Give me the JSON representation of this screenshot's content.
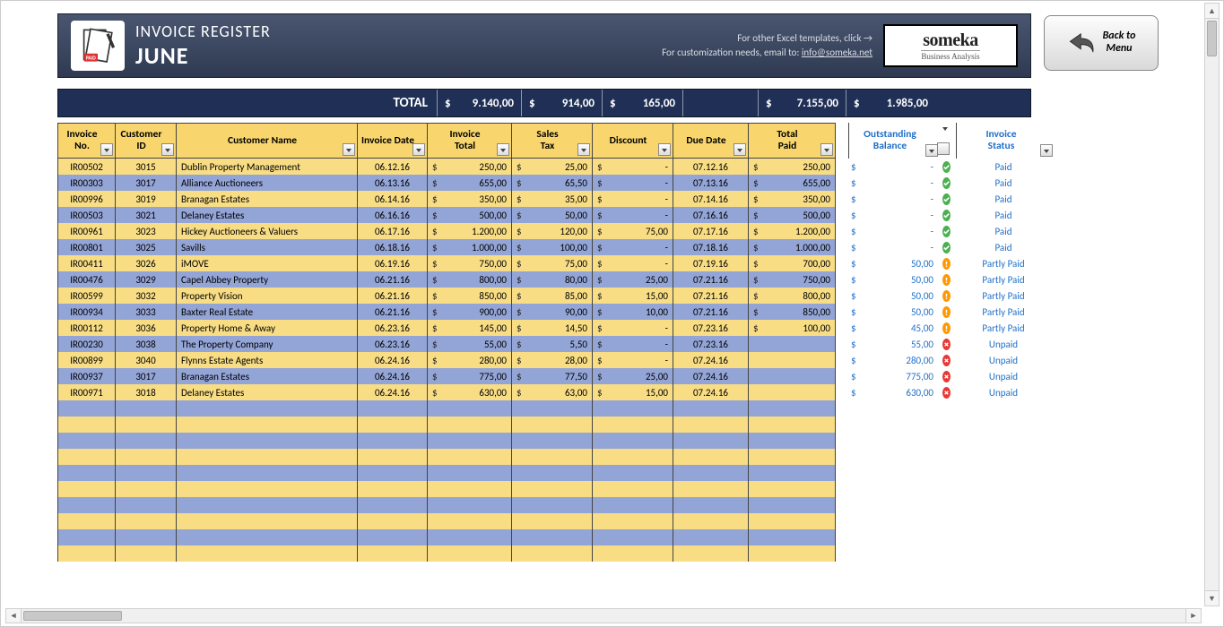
{
  "header": {
    "title": "INVOICE REGISTER",
    "month": "JUNE",
    "tip1": "For other Excel templates, click →",
    "tip2_pre": "For customization needs, email to: ",
    "tip2_link": "info@someka.net",
    "logo_name": "someka",
    "logo_sub": "Business Analysis",
    "back_label": "Back to\nMenu"
  },
  "totals": {
    "label": "TOTAL",
    "invoice_total": "9.140,00",
    "sales_tax": "914,00",
    "discount": "165,00",
    "total_paid": "7.155,00",
    "outstanding": "1.985,00"
  },
  "columns": [
    "Invoice\nNo.",
    "Customer\nID",
    "Customer Name",
    "Invoice Date",
    "Invoice\nTotal",
    "Sales\nTax",
    "Discount",
    "Due Date",
    "Total\nPaid",
    "Outstanding\nBalance",
    "Invoice\nStatus"
  ],
  "rows": [
    {
      "inv": "IR00502",
      "cust": "3015",
      "name": "Dublin Property Management",
      "idate": "06.12.16",
      "itot": "250,00",
      "tax": "25,00",
      "disc": "-",
      "due": "07.12.16",
      "paid": "250,00",
      "out": "-",
      "status": "Paid"
    },
    {
      "inv": "IR00303",
      "cust": "3017",
      "name": "Alliance Auctioneers",
      "idate": "06.13.16",
      "itot": "655,00",
      "tax": "65,50",
      "disc": "-",
      "due": "07.13.16",
      "paid": "655,00",
      "out": "-",
      "status": "Paid"
    },
    {
      "inv": "IR00996",
      "cust": "3019",
      "name": "Branagan Estates",
      "idate": "06.14.16",
      "itot": "350,00",
      "tax": "35,00",
      "disc": "-",
      "due": "07.14.16",
      "paid": "350,00",
      "out": "-",
      "status": "Paid"
    },
    {
      "inv": "IR00503",
      "cust": "3021",
      "name": "Delaney Estates",
      "idate": "06.16.16",
      "itot": "500,00",
      "tax": "50,00",
      "disc": "-",
      "due": "07.16.16",
      "paid": "500,00",
      "out": "-",
      "status": "Paid"
    },
    {
      "inv": "IR00961",
      "cust": "3023",
      "name": "Hickey Auctioneers & Valuers",
      "idate": "06.17.16",
      "itot": "1.200,00",
      "tax": "120,00",
      "disc": "75,00",
      "due": "07.17.16",
      "paid": "1.200,00",
      "out": "-",
      "status": "Paid"
    },
    {
      "inv": "IR00801",
      "cust": "3025",
      "name": "Savills",
      "idate": "06.18.16",
      "itot": "1.000,00",
      "tax": "100,00",
      "disc": "-",
      "due": "07.18.16",
      "paid": "1.000,00",
      "out": "-",
      "status": "Paid"
    },
    {
      "inv": "IR00411",
      "cust": "3026",
      "name": "iMOVE",
      "idate": "06.19.16",
      "itot": "750,00",
      "tax": "75,00",
      "disc": "-",
      "due": "07.19.16",
      "paid": "700,00",
      "out": "50,00",
      "status": "Partly Paid"
    },
    {
      "inv": "IR00476",
      "cust": "3029",
      "name": "Capel Abbey Property",
      "idate": "06.21.16",
      "itot": "800,00",
      "tax": "80,00",
      "disc": "25,00",
      "due": "07.21.16",
      "paid": "750,00",
      "out": "50,00",
      "status": "Partly Paid"
    },
    {
      "inv": "IR00599",
      "cust": "3032",
      "name": "Property Vision",
      "idate": "06.21.16",
      "itot": "850,00",
      "tax": "85,00",
      "disc": "15,00",
      "due": "07.21.16",
      "paid": "800,00",
      "out": "50,00",
      "status": "Partly Paid"
    },
    {
      "inv": "IR00934",
      "cust": "3033",
      "name": "Baxter Real Estate",
      "idate": "06.21.16",
      "itot": "900,00",
      "tax": "90,00",
      "disc": "10,00",
      "due": "07.21.16",
      "paid": "850,00",
      "out": "50,00",
      "status": "Partly Paid"
    },
    {
      "inv": "IR00112",
      "cust": "3036",
      "name": "Property Home & Away",
      "idate": "06.23.16",
      "itot": "145,00",
      "tax": "14,50",
      "disc": "-",
      "due": "07.23.16",
      "paid": "100,00",
      "out": "45,00",
      "status": "Partly Paid"
    },
    {
      "inv": "IR00230",
      "cust": "3038",
      "name": "The Property Company",
      "idate": "06.23.16",
      "itot": "55,00",
      "tax": "5,50",
      "disc": "-",
      "due": "07.23.16",
      "paid": "",
      "out": "55,00",
      "status": "Unpaid"
    },
    {
      "inv": "IR00899",
      "cust": "3040",
      "name": "Flynns Estate Agents",
      "idate": "06.24.16",
      "itot": "280,00",
      "tax": "28,00",
      "disc": "-",
      "due": "07.24.16",
      "paid": "",
      "out": "280,00",
      "status": "Unpaid"
    },
    {
      "inv": "IR00937",
      "cust": "3017",
      "name": "Branagan Estates",
      "idate": "06.24.16",
      "itot": "775,00",
      "tax": "77,50",
      "disc": "25,00",
      "due": "07.24.16",
      "paid": "",
      "out": "775,00",
      "status": "Unpaid"
    },
    {
      "inv": "IR00971",
      "cust": "3018",
      "name": "Delaney Estates",
      "idate": "06.24.16",
      "itot": "630,00",
      "tax": "63,00",
      "disc": "15,00",
      "due": "07.24.16",
      "paid": "",
      "out": "630,00",
      "status": "Unpaid"
    }
  ],
  "empty_rows": 10
}
